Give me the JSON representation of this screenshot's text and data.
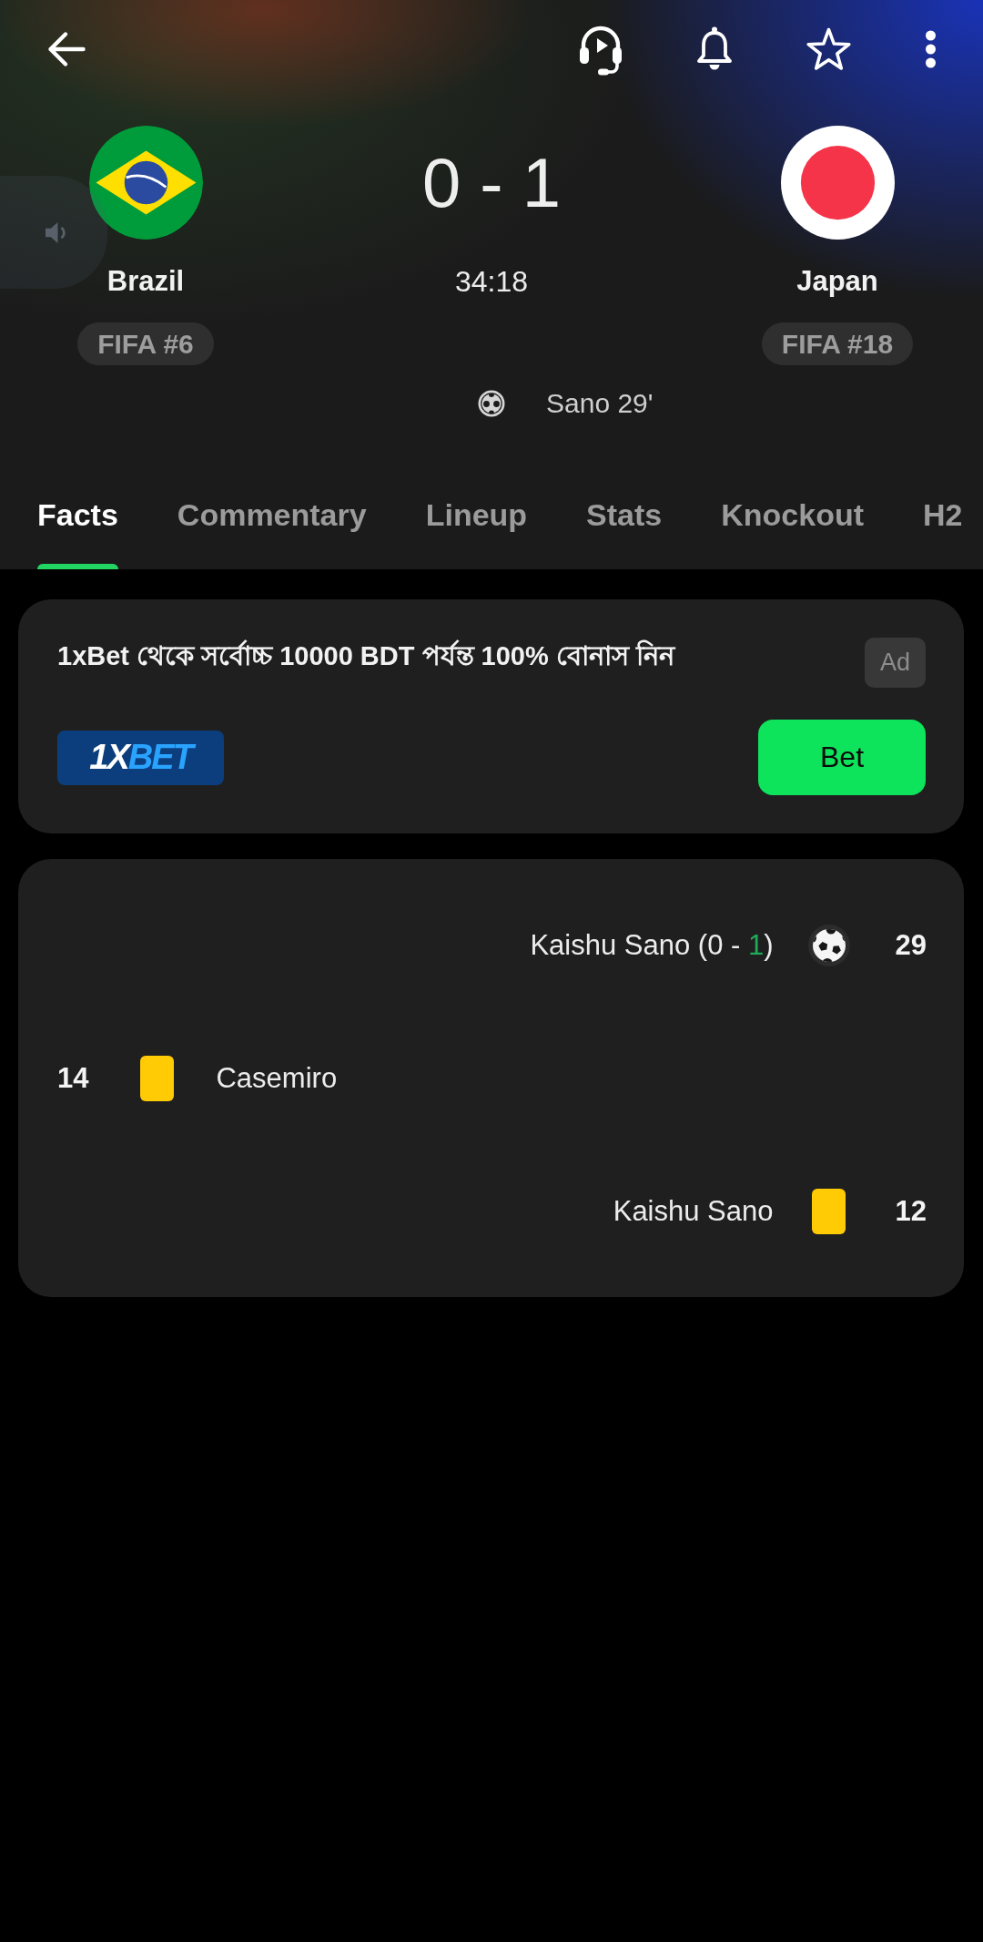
{
  "teams": [
    {
      "name": "Brazil",
      "rank": "FIFA #6"
    },
    {
      "name": "Japan",
      "rank": "FIFA #18",
      "goals": [
        "Sano 29'"
      ]
    }
  ],
  "match": {
    "score": "0 - 1",
    "clock": "34:18"
  },
  "tabs": [
    {
      "label": "Facts",
      "selected": true
    },
    {
      "label": "Commentary",
      "selected": false
    },
    {
      "label": "Lineup",
      "selected": false
    },
    {
      "label": "Stats",
      "selected": false
    },
    {
      "label": "Knockout",
      "selected": false
    },
    {
      "label": "H2",
      "selected": false
    }
  ],
  "ad": {
    "title": "1xBet থেকে সর্বোচ্চ 10000 BDT পর্যন্ত 100% বোনাস নিন",
    "label": "Ad",
    "logo_parts": [
      {
        "text": "1X",
        "accent": false
      },
      {
        "text": "BET",
        "accent": true
      }
    ],
    "button": "Bet"
  },
  "events": [
    {
      "kind": "goal",
      "away": true,
      "minute": "29",
      "text_parts": [
        {
          "text": "Kaishu Sano (0 - ",
          "highlight": false
        },
        {
          "text": "1",
          "highlight": true
        },
        {
          "text": ")",
          "highlight": false
        }
      ]
    },
    {
      "kind": "yellow_card",
      "away": false,
      "minute": "14",
      "text_parts": [
        {
          "text": "Casemiro",
          "highlight": false
        }
      ]
    },
    {
      "kind": "yellow_card",
      "away": true,
      "minute": "12",
      "text_parts": [
        {
          "text": "Kaishu Sano",
          "highlight": false
        }
      ]
    }
  ]
}
